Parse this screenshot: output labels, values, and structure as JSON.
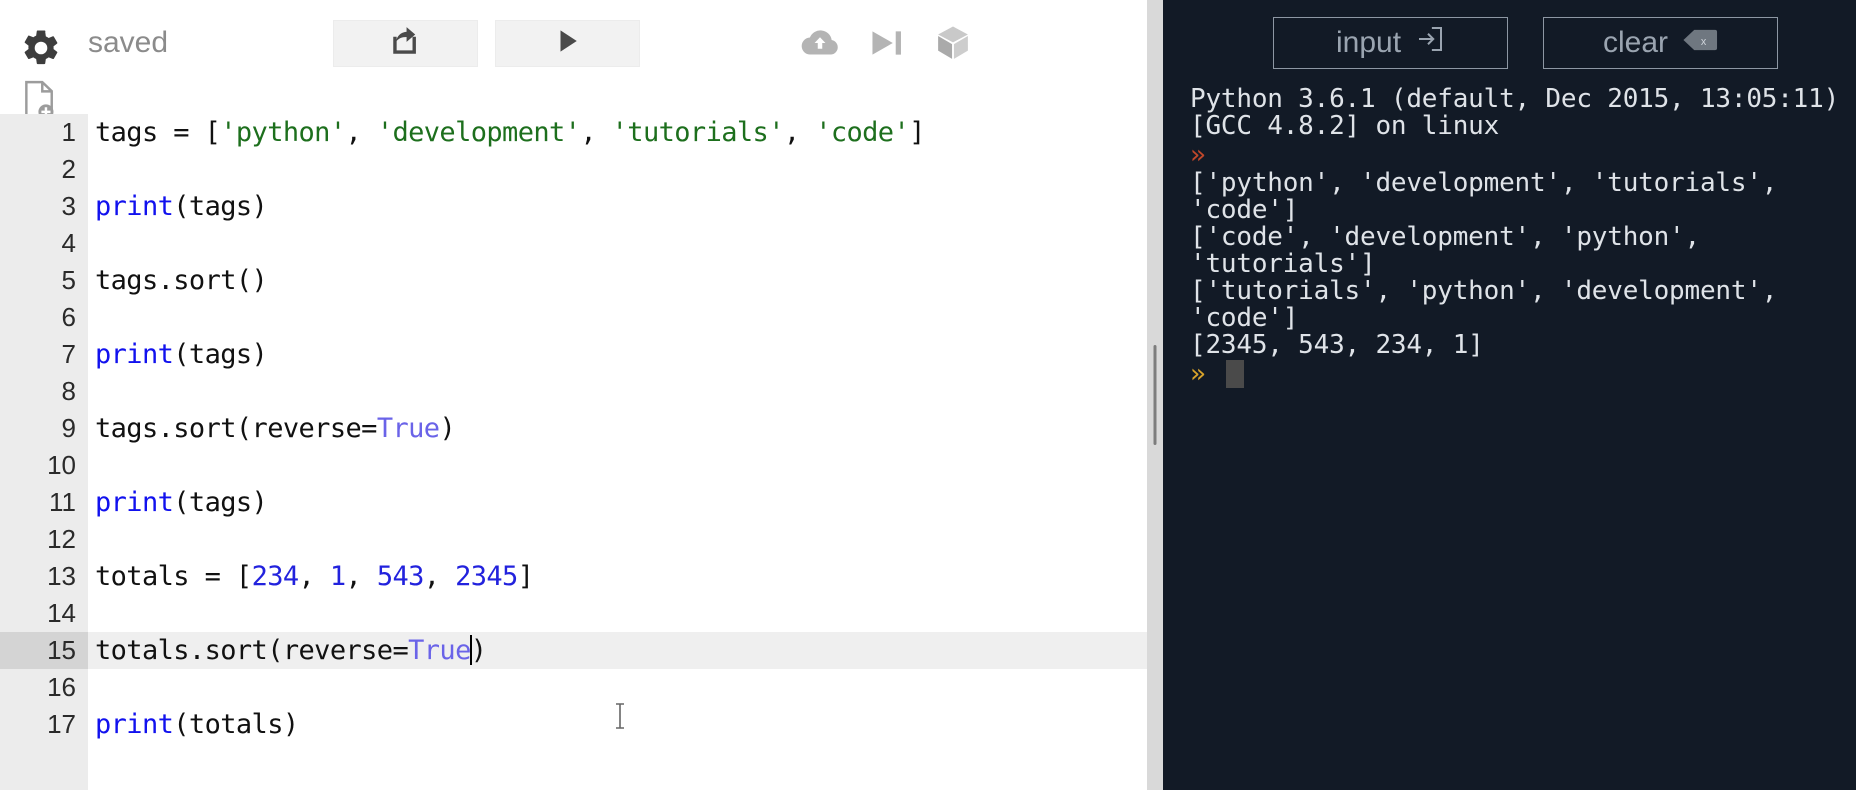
{
  "editor": {
    "status_label": "saved",
    "icons": {
      "settings": "gear-icon",
      "new_file": "new-file-icon",
      "share": "share-icon",
      "run": "play-icon",
      "cloud_upload": "cloud-upload-icon",
      "step": "step-forward-icon",
      "package": "cube-icon"
    },
    "active_line": 15,
    "cursor_column_after": "True",
    "lines": [
      {
        "num": "1",
        "tokens": [
          {
            "t": "tags ",
            "c": "plain"
          },
          {
            "t": "= ",
            "c": "op"
          },
          {
            "t": "[",
            "c": "plain"
          },
          {
            "t": "'python'",
            "c": "str"
          },
          {
            "t": ", ",
            "c": "plain"
          },
          {
            "t": "'development'",
            "c": "str"
          },
          {
            "t": ", ",
            "c": "plain"
          },
          {
            "t": "'tutorials'",
            "c": "str"
          },
          {
            "t": ", ",
            "c": "plain"
          },
          {
            "t": "'code'",
            "c": "str"
          },
          {
            "t": "]",
            "c": "plain"
          }
        ]
      },
      {
        "num": "2",
        "tokens": []
      },
      {
        "num": "3",
        "tokens": [
          {
            "t": "print",
            "c": "fn"
          },
          {
            "t": "(tags)",
            "c": "plain"
          }
        ]
      },
      {
        "num": "4",
        "tokens": []
      },
      {
        "num": "5",
        "tokens": [
          {
            "t": "tags.sort()",
            "c": "plain"
          }
        ]
      },
      {
        "num": "6",
        "tokens": []
      },
      {
        "num": "7",
        "tokens": [
          {
            "t": "print",
            "c": "fn"
          },
          {
            "t": "(tags)",
            "c": "plain"
          }
        ]
      },
      {
        "num": "8",
        "tokens": []
      },
      {
        "num": "9",
        "tokens": [
          {
            "t": "tags.sort(reverse",
            "c": "plain"
          },
          {
            "t": "=",
            "c": "op"
          },
          {
            "t": "True",
            "c": "kw"
          },
          {
            "t": ")",
            "c": "plain"
          }
        ]
      },
      {
        "num": "10",
        "tokens": []
      },
      {
        "num": "11",
        "tokens": [
          {
            "t": "print",
            "c": "fn"
          },
          {
            "t": "(tags)",
            "c": "plain"
          }
        ]
      },
      {
        "num": "12",
        "tokens": []
      },
      {
        "num": "13",
        "tokens": [
          {
            "t": "totals ",
            "c": "plain"
          },
          {
            "t": "= ",
            "c": "op"
          },
          {
            "t": "[",
            "c": "plain"
          },
          {
            "t": "234",
            "c": "num"
          },
          {
            "t": ", ",
            "c": "plain"
          },
          {
            "t": "1",
            "c": "num"
          },
          {
            "t": ", ",
            "c": "plain"
          },
          {
            "t": "543",
            "c": "num"
          },
          {
            "t": ", ",
            "c": "plain"
          },
          {
            "t": "2345",
            "c": "num"
          },
          {
            "t": "]",
            "c": "plain"
          }
        ]
      },
      {
        "num": "14",
        "tokens": []
      },
      {
        "num": "15",
        "tokens": [
          {
            "t": "totals.sort(reverse",
            "c": "plain"
          },
          {
            "t": "=",
            "c": "op"
          },
          {
            "t": "True",
            "c": "kw"
          },
          {
            "t": "#CARET#",
            "c": "caret"
          },
          {
            "t": ")",
            "c": "plain"
          }
        ]
      },
      {
        "num": "16",
        "tokens": []
      },
      {
        "num": "17",
        "tokens": [
          {
            "t": "print",
            "c": "fn"
          },
          {
            "t": "(totals)",
            "c": "plain"
          }
        ]
      }
    ]
  },
  "console": {
    "input_button_label": "input",
    "clear_button_label": "clear",
    "input_icon": "enter-box-icon",
    "clear_icon": "backspace-icon",
    "output": [
      {
        "kind": "text",
        "text": "Python 3.6.1 (default, Dec 2015, 13:05:11)"
      },
      {
        "kind": "text",
        "text": "[GCC 4.8.2] on linux"
      },
      {
        "kind": "prompt",
        "color": "red",
        "cursor": false
      },
      {
        "kind": "text",
        "text": "['python', 'development', 'tutorials', 'code']"
      },
      {
        "kind": "text",
        "text": "['code', 'development', 'python', 'tutorials']"
      },
      {
        "kind": "text",
        "text": "['tutorials', 'python', 'development', 'code']"
      },
      {
        "kind": "text",
        "text": "[2345, 543, 234, 1]"
      },
      {
        "kind": "prompt",
        "color": "yellow",
        "cursor": true
      }
    ]
  },
  "colors": {
    "console_bg": "#121a26",
    "console_text": "#dfe3e8",
    "gutter_bg": "#ececec",
    "active_line_bg": "#efefef",
    "string_green": "#1d6f1d",
    "function_blue": "#1111ee",
    "number_blue": "#2222dd",
    "keyword_purple": "#6a63e8",
    "prompt_red": "#c0472a",
    "prompt_yellow": "#d8a32a",
    "splitter_gray": "#d9d9d9"
  }
}
